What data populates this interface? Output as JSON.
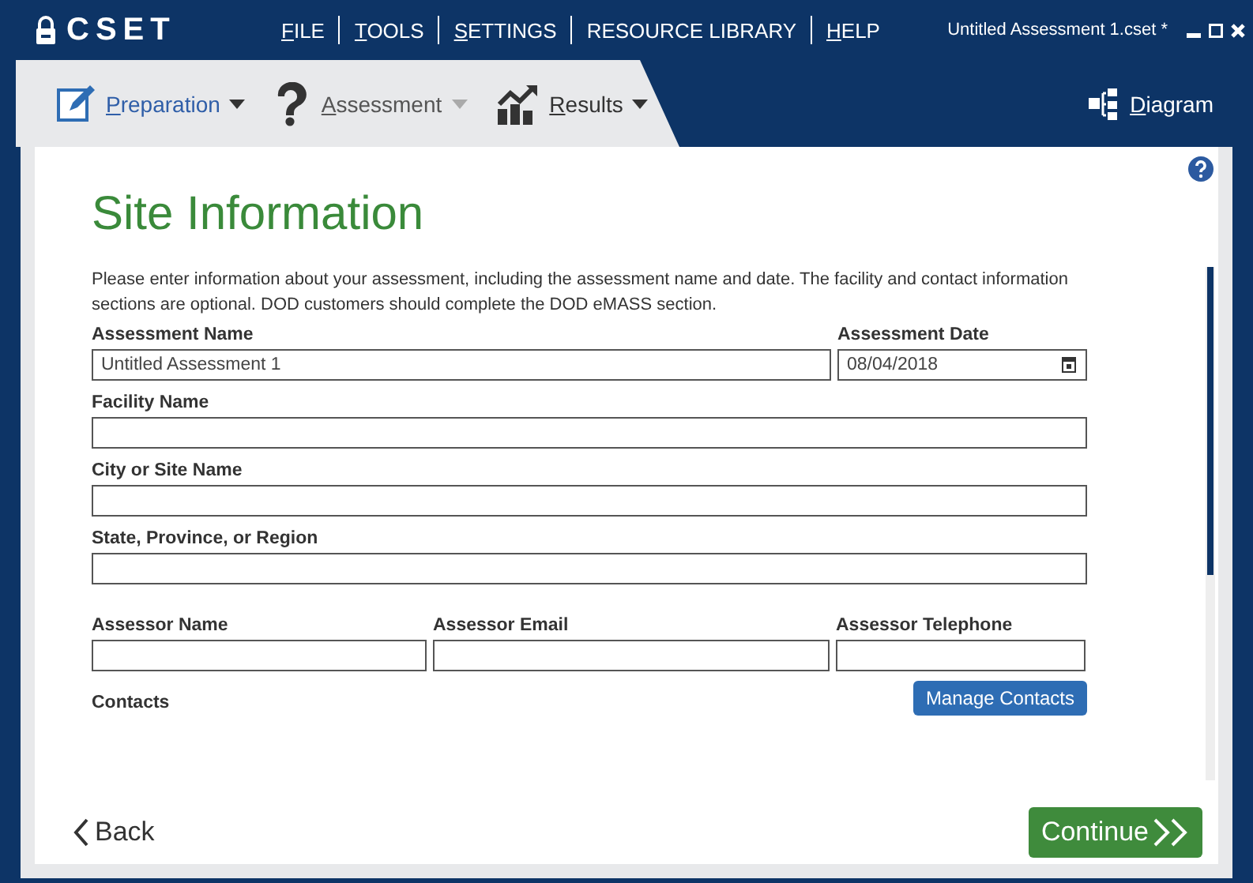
{
  "app": {
    "logo": "CSET",
    "document_title": "Untitled Assessment 1.cset *"
  },
  "menu": [
    {
      "label": "FILE",
      "access_first": true
    },
    {
      "label": "TOOLS",
      "access_first": true
    },
    {
      "label": "SETTINGS",
      "access_first": true
    },
    {
      "label": "RESOURCE LIBRARY",
      "access_first": false
    },
    {
      "label": "HELP",
      "access_first": true
    }
  ],
  "nav": [
    {
      "label": "Preparation",
      "kind": "edit",
      "selected": true,
      "disabled": false
    },
    {
      "label": "Assessment",
      "kind": "question",
      "selected": false,
      "disabled": true
    },
    {
      "label": "Results",
      "kind": "chart",
      "selected": false,
      "disabled": false
    }
  ],
  "diagram": {
    "label": "Diagram"
  },
  "page": {
    "title": "Site Information",
    "intro": "Please enter information about your assessment, including the assessment name and date. The facility and contact information sections are optional. DOD customers should complete the DOD eMASS section.",
    "fields": [
      {
        "label": "Assessment Name",
        "value": "Untitled Assessment 1",
        "kind": "wide"
      },
      {
        "label": "Assessment Date",
        "value": "08/04/2018",
        "kind": "date"
      },
      {
        "label": "Facility Name",
        "kind": "full"
      },
      {
        "label": "City or Site Name",
        "kind": "full"
      },
      {
        "label": "State, Province, or Region",
        "kind": "full"
      },
      {
        "label": "Assessor Name",
        "kind": "a"
      },
      {
        "label": "Assessor Email",
        "kind": "b"
      },
      {
        "label": "Assessor Telephone",
        "kind": "c"
      }
    ],
    "contacts_label": "Contacts",
    "manage_button": "Manage Contacts"
  },
  "footer": {
    "back": "Back",
    "continue": "Continue"
  }
}
